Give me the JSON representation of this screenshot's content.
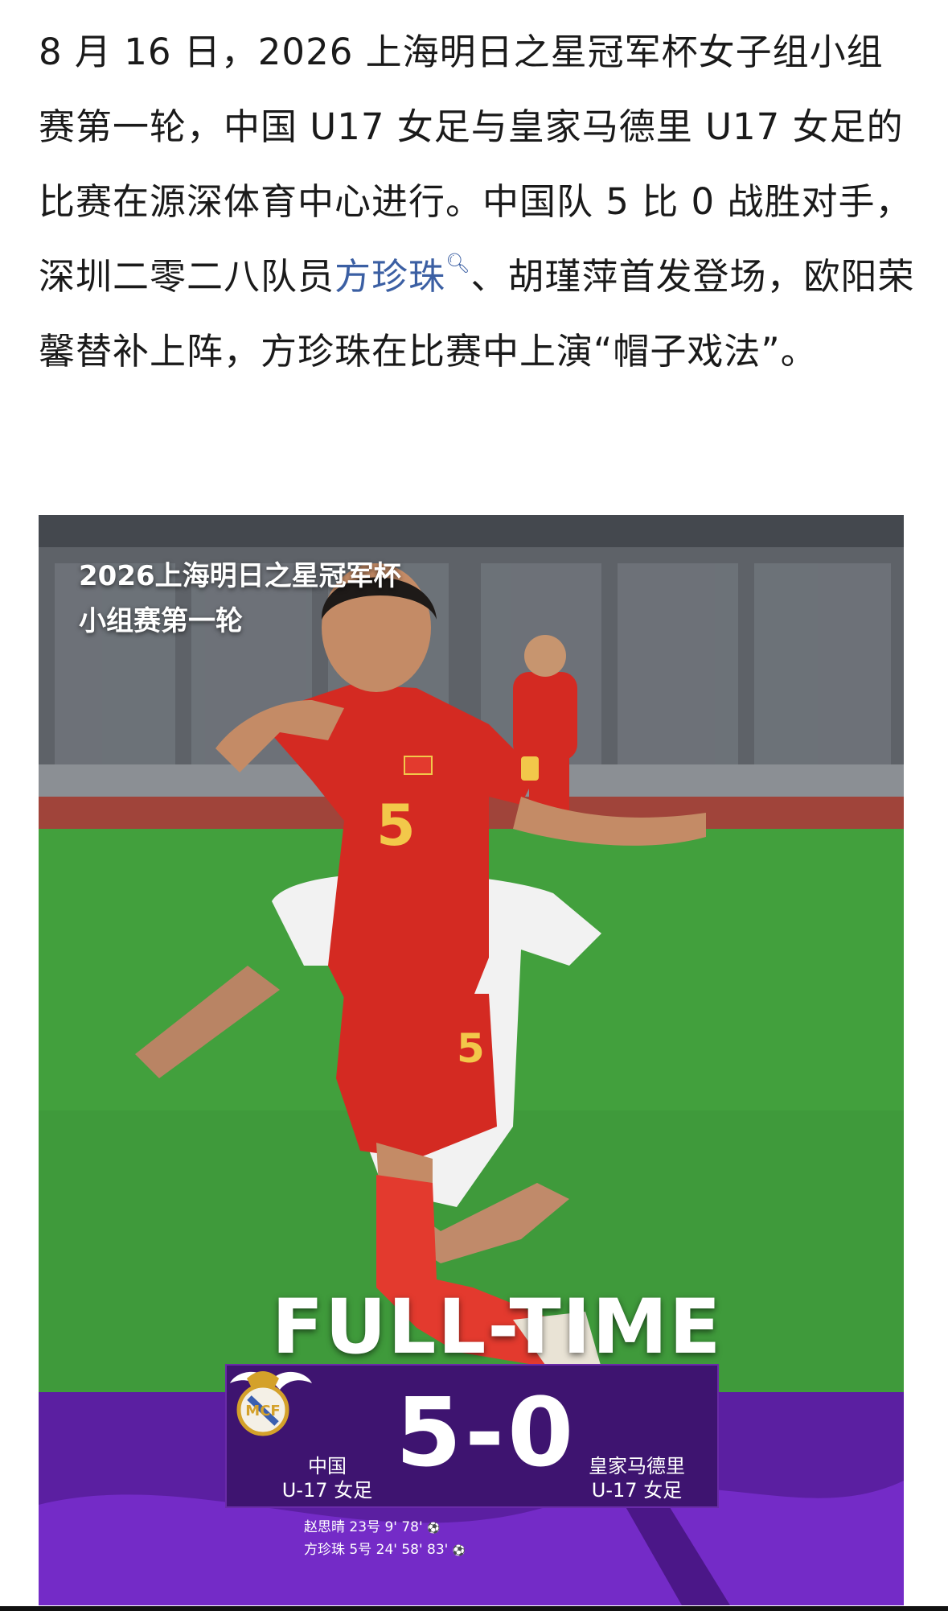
{
  "article": {
    "p1": "8 月 16 日，2026 上海明日之星冠军杯女子组小组赛第一轮，中国 U17 女足与皇家马德里 U17 女足的比赛在源深体育中心进行。中国队 5 比 0 战胜对手，深圳二零二八队员",
    "player_link": "方珍珠",
    "p2": "、胡瑾萍首发登场，欧阳荣馨替补上阵，方珍珠在比赛中上演“帽子戏法”。"
  },
  "image": {
    "title_line1": "2026上海明日之星冠军杯",
    "title_line2": "小组赛第一轮",
    "fulltime": "FULL-TIME",
    "score": "5-0",
    "home_name": "中国",
    "home_sub": "U-17 女足",
    "away_name": "皇家马德里",
    "away_sub": "U-17 女足",
    "jersey_number": "5",
    "scorer1": "赵思晴 23号 9' 78'",
    "scorer2": "方珍珠 5号 24' 58' 83'",
    "ball_icon": "⚽"
  },
  "colors": {
    "link": "#3b5fa3",
    "purple": "#3e1470",
    "red_kit": "#d42a22"
  }
}
